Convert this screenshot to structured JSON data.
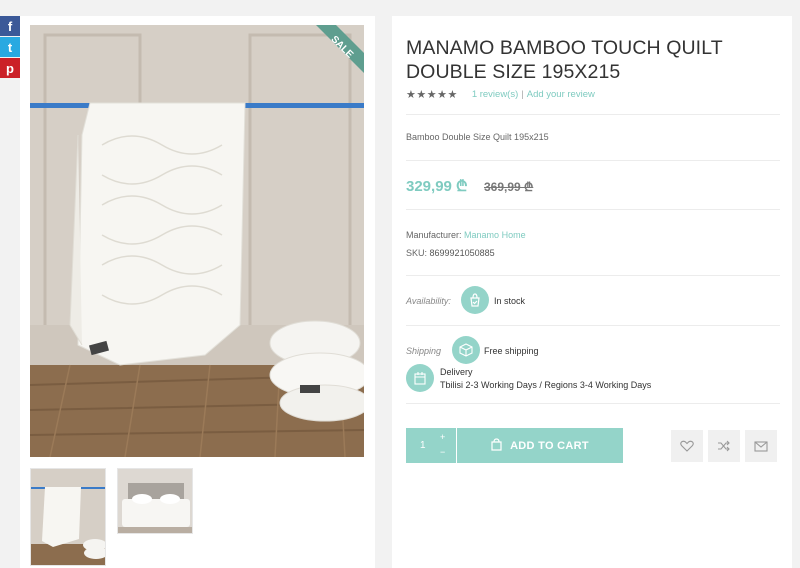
{
  "share": {
    "facebook": "f",
    "twitter": "t",
    "pinterest": "p"
  },
  "badge": "SALE",
  "product": {
    "title": "MANAMO BAMBOO TOUCH QUILT DOUBLE SIZE 195X215",
    "rating_stars": "★★★★★",
    "reviews_link": "1 review(s)",
    "reviews_sep": "|",
    "add_review_link": "Add your review",
    "short_description": "Bamboo Double Size Quilt 195x215",
    "price": "329,99 ₾",
    "old_price": "369,99 ₾",
    "manufacturer_label": "Manufacturer:",
    "manufacturer_value": "Manamo Home",
    "sku_label": "SKU:",
    "sku_value": "8699921050885",
    "availability_label": "Availability:",
    "availability_value": "In stock",
    "shipping_label": "Shipping",
    "shipping_value": "Free shipping",
    "delivery_title": "Delivery",
    "delivery_value": "Tbilisi 2-3 Working Days / Regions 3-4 Working Days"
  },
  "cart": {
    "quantity": "1",
    "plus": "+",
    "minus": "−",
    "add_to_cart": "ADD TO CART"
  },
  "colors": {
    "accent": "#94d4c9",
    "badge": "#5f9e8f",
    "link": "#7fcbc0"
  }
}
